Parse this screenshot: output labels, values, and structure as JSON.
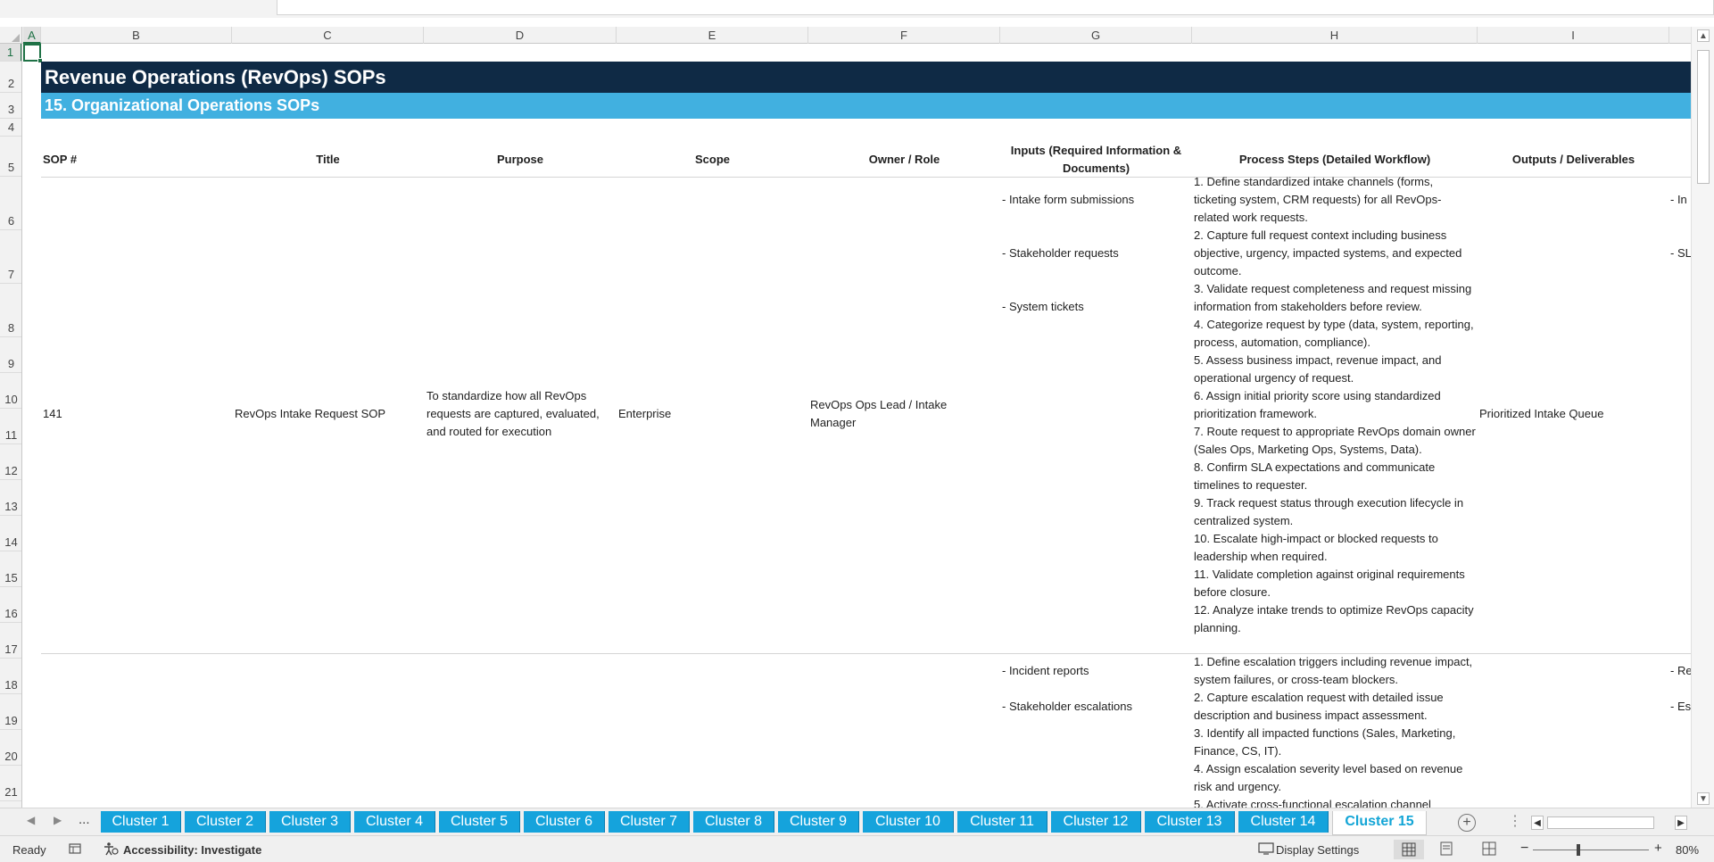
{
  "columns": [
    "A",
    "B",
    "C",
    "D",
    "E",
    "F",
    "G",
    "H",
    "I"
  ],
  "rows": [
    "1",
    "2",
    "3",
    "4",
    "5",
    "6",
    "7",
    "8",
    "9",
    "10",
    "11",
    "12",
    "13",
    "14",
    "15",
    "16",
    "17",
    "18",
    "19",
    "20",
    "21"
  ],
  "banner": {
    "title": "Revenue Operations (RevOps) SOPs",
    "subtitle": "15. Organizational Operations SOPs"
  },
  "table_headers": {
    "sop": "SOP #",
    "title": "Title",
    "purpose": "Purpose",
    "scope": "Scope",
    "owner": "Owner / Role",
    "inputs": "Inputs (Required Information & Documents)",
    "steps": "Process Steps (Detailed Workflow)",
    "outputs": "Outputs / Deliverables"
  },
  "rows_data": [
    {
      "sop": "141",
      "title": "RevOps Intake Request SOP",
      "purpose": "To standardize how all RevOps requests are captured, evaluated, and routed for execution",
      "scope": "Enterprise",
      "owner": "RevOps Ops Lead / Intake Manager",
      "inputs": [
        "- Intake form submissions",
        "- Stakeholder requests",
        "- System tickets"
      ],
      "steps": [
        "1. Define standardized intake channels (forms, ticketing system, CRM requests) for all RevOps-related work requests.",
        "2. Capture full request context including business objective, urgency, impacted systems, and expected outcome.",
        "3. Validate request completeness and request missing information from stakeholders before review.",
        "4. Categorize request by type (data, system, reporting, process, automation, compliance).",
        "5. Assess business impact, revenue impact, and operational urgency of request.",
        "6. Assign initial priority score using standardized prioritization framework.",
        "7. Route request to appropriate RevOps domain owner (Sales Ops, Marketing Ops, Systems, Data).",
        "8. Confirm SLA expectations and communicate timelines to requester.",
        "9. Track request status through execution lifecycle in centralized system.",
        "10. Escalate high-impact or blocked requests to leadership when required.",
        "11. Validate completion against original requirements before closure.",
        "12. Analyze intake trends to optimize RevOps capacity planning."
      ],
      "outputs": "Prioritized Intake Queue",
      "next_col_fragments": [
        "- In",
        "- SL"
      ]
    },
    {
      "inputs": [
        "- Incident reports",
        "- Stakeholder escalations"
      ],
      "steps": [
        "1. Define escalation triggers including revenue impact, system failures, or cross-team blockers.",
        "2. Capture escalation request with detailed issue description and business impact assessment.",
        "3. Identify all impacted functions (Sales, Marketing, Finance, CS, IT).",
        "4. Assign escalation severity level based on revenue risk and urgency.",
        "5. Activate cross-functional escalation channel"
      ],
      "next_col_fragments": [
        "- Re",
        "- Es"
      ]
    }
  ],
  "sheet_tabs": [
    "Cluster 1",
    "Cluster 2",
    "Cluster 3",
    "Cluster 4",
    "Cluster 5",
    "Cluster 6",
    "Cluster 7",
    "Cluster 8",
    "Cluster 9",
    "Cluster 10",
    "Cluster 11",
    "Cluster 12",
    "Cluster 13",
    "Cluster 14",
    "Cluster 15"
  ],
  "active_tab": "Cluster 15",
  "tab_nav": {
    "prev": "◀",
    "next": "▶",
    "more": "..."
  },
  "status": {
    "ready": "Ready",
    "accessibility": "Accessibility: Investigate",
    "display_settings": "Display Settings",
    "zoom": "80%",
    "zoom_minus": "−",
    "zoom_plus": "+"
  },
  "colors": {
    "banner_dark": "#0f2a45",
    "banner_light": "#41b0e0",
    "tab": "#15a3dc",
    "selection": "#1e7145"
  }
}
